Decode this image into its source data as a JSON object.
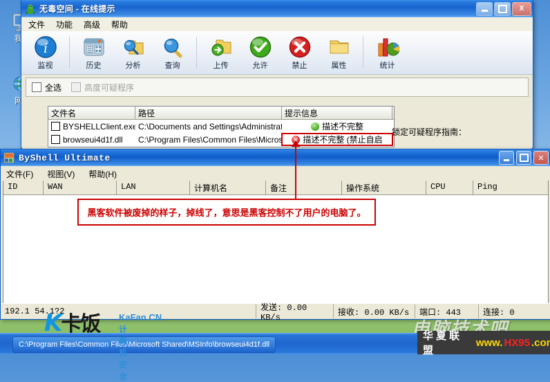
{
  "desktop": {
    "icons": [
      {
        "name": "my-computer",
        "label": "我的",
        "glyph": "monitor-icon"
      },
      {
        "name": "network-places",
        "label": "网上",
        "glyph": "globe-icon"
      }
    ]
  },
  "window1": {
    "title": "无毒空间 - 在线提示",
    "app_icon": "green-mascot-icon",
    "buttons": {
      "minimize": "_",
      "maximize": "□",
      "close": "X"
    },
    "menu": [
      "文件",
      "功能",
      "高级",
      "帮助"
    ],
    "toolbar": [
      {
        "label": "监视",
        "icon": "info-circle-icon"
      },
      {
        "label": "历史",
        "icon": "history-book-icon"
      },
      {
        "label": "分析",
        "icon": "magnifier-folder-icon"
      },
      {
        "label": "查询",
        "icon": "magnifier-icon"
      },
      {
        "label": "上传",
        "icon": "upload-folder-icon"
      },
      {
        "label": "允许",
        "icon": "green-check-icon"
      },
      {
        "label": "禁止",
        "icon": "red-cross-icon"
      },
      {
        "label": "属性",
        "icon": "folder-icon"
      },
      {
        "label": "统计",
        "icon": "bar-chart-icon"
      }
    ],
    "checkboxes": [
      {
        "label": "全选",
        "checked": false,
        "disabled": false
      },
      {
        "label": "高度可疑程序",
        "checked": false,
        "disabled": true
      }
    ],
    "list": {
      "headers": [
        "文件名",
        "路径",
        "提示信息"
      ],
      "rows": [
        {
          "filename": "BYSHELLClient.exe",
          "path": "C:\\Documents and Settings\\Administrator\\...",
          "status": "描述不完整",
          "status_icon": "green-dot-icon",
          "highlighted": false
        },
        {
          "filename": "browseui4d1f.dll",
          "path": "C:\\Program Files\\Common Files\\Microsoft ...",
          "status": "描述不完整 (禁止自启",
          "status_icon": "red-cross-dot-icon",
          "highlighted": true
        }
      ]
    },
    "guide_label": "锁定可疑程序指南："
  },
  "window2": {
    "title": "ByShell Ultimate",
    "app_icon": "byshell-icon",
    "buttons": {
      "minimize": "_",
      "maximize": "□",
      "close": "✕"
    },
    "menu": [
      "文件(F)",
      "视图(V)",
      "帮助(H)"
    ],
    "grid": {
      "headers": [
        "ID",
        "WAN",
        "LAN",
        "计算机名",
        "备注",
        "操作系统",
        "CPU",
        "Ping"
      ],
      "rows": []
    },
    "statusbar": {
      "address": "192.1     54.1?2",
      "send": "发送:  0.00  KB/s",
      "receive": "接收:  0.00  KB/s",
      "port": "端口:  443",
      "connections": "连接: 0"
    }
  },
  "annotation": {
    "text": "黑客软件被废掉的样子，掉线了，意思是黑客控制不了用户的电脑了。",
    "color": "#cc0000"
  },
  "taskbar": {
    "item_label": "C:\\Program Files\\Common Files\\Microsoft Shared\\MSInfo\\browseui4d1f.dll"
  },
  "watermarks": {
    "kafan_logo": "卡饭",
    "kafan_k": "K",
    "kafan_site": "KaFan.CN",
    "kafan_sub": "计算机安全",
    "tech_bar": "电脑技术吧",
    "hx_alliance": "华夏联盟",
    "hx_www": "www.",
    "hx_name": "HX95",
    "hx_tld": ".com"
  }
}
